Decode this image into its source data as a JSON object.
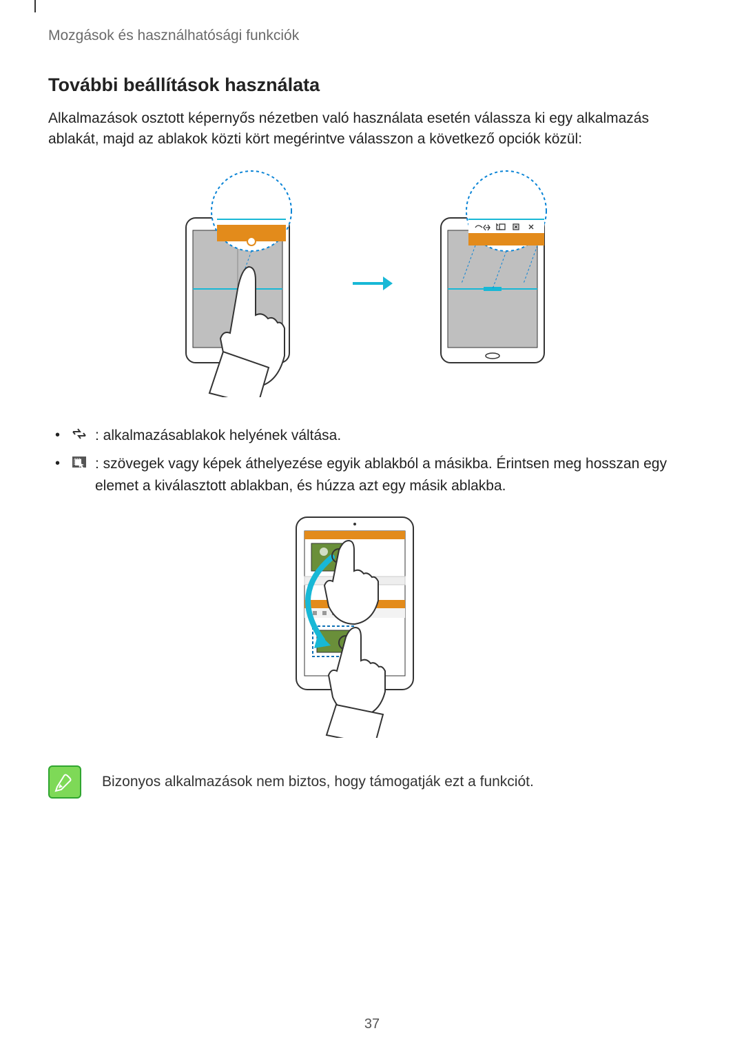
{
  "breadcrumb": "Mozgások és használhatósági funkciók",
  "section_title": "További beállítások használata",
  "intro": "Alkalmazások osztott képernyős nézetben való használata esetén válassza ki egy alkalmazás ablakát, majd az ablakok közti kört megérintve válasszon a következő opciók közül:",
  "list": {
    "item1": " : alkalmazásablakok helyének váltása.",
    "item2": " : szövegek vagy képek áthelyezése egyik ablakból a másikba. Érintsen meg hosszan egy elemet a kiválasztott ablakban, és húzza azt egy másik ablakba."
  },
  "note_text": "Bizonyos alkalmazások nem biztos, hogy támogatják ezt a funkciót.",
  "page_number": "37"
}
